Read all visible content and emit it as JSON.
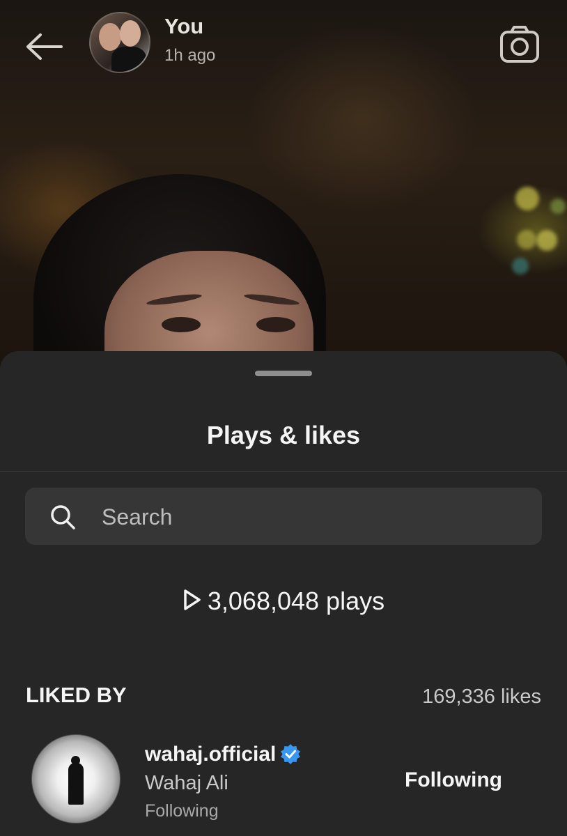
{
  "header": {
    "owner_name": "You",
    "timestamp": "1h ago",
    "back_icon": "arrow-left-icon",
    "camera_icon": "camera-icon"
  },
  "sheet": {
    "title": "Plays & likes",
    "search": {
      "placeholder": "Search",
      "value": ""
    },
    "plays_text": "3,068,048 plays",
    "liked_by_label": "LIKED BY",
    "likes_count": "169,336 likes",
    "likers": [
      {
        "username": "wahaj.official",
        "verified": true,
        "full_name": "Wahaj Ali",
        "relation": "Following",
        "action_label": "Following"
      }
    ]
  },
  "colors": {
    "sheet_bg": "#262626",
    "search_bg": "#363636",
    "verified_blue": "#3897f0"
  }
}
